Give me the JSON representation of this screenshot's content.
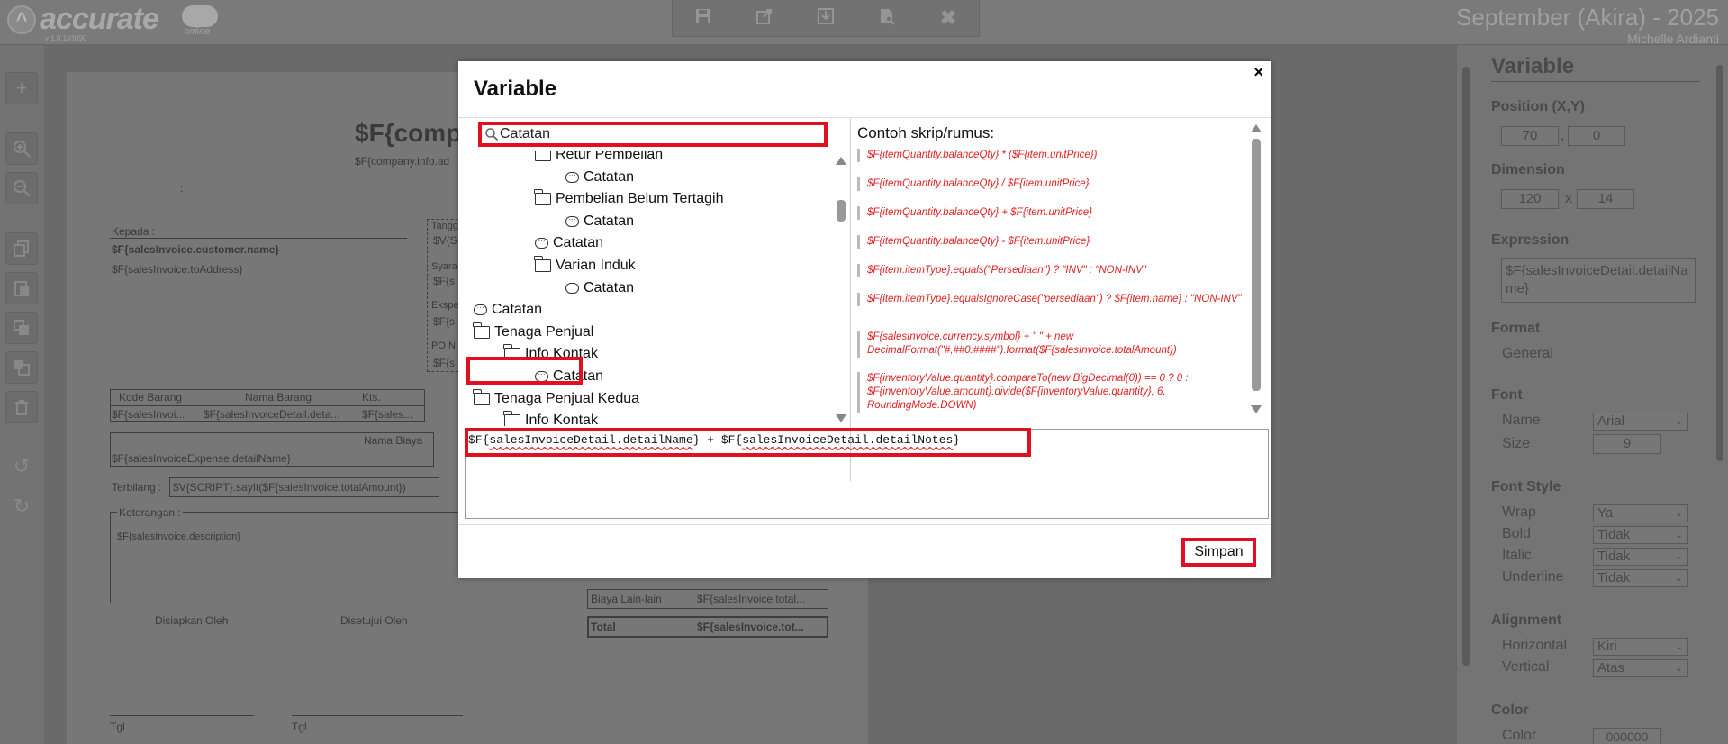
{
  "app": {
    "logo_text": "accurate",
    "logo_sub": "online",
    "version": "v 1.0.1#3090",
    "period": "September (Akira) - 2025",
    "user": "Michelle Ardianti"
  },
  "toolbar": {
    "icons": [
      "save-icon",
      "export-icon",
      "download-icon",
      "preview-icon",
      "close-icon"
    ]
  },
  "leftbar": {
    "icons": [
      "add-icon",
      "zoom-in-icon",
      "zoom-out-icon",
      "copy-icon",
      "paste-icon",
      "bring-front-icon",
      "send-back-icon",
      "delete-icon",
      "undo-icon",
      "redo-icon"
    ]
  },
  "document": {
    "company_name": "$F{compa",
    "company_address": "$F{company.info.ad",
    "colon": ":",
    "to_label": "Kepada :",
    "customer_name": "$F{salesInvoice.customer.name}",
    "to_address": "$F{salesInvoice.toAddress}",
    "date_label": "Tangg",
    "date_var": "$V{S",
    "terms_label": "Syara",
    "terms_var": "$F{s",
    "ship_label": "Ekspe",
    "ship_var": "$F{s",
    "po_label": "PO N",
    "po_var": "$F{s",
    "col_code": "Kode Barang",
    "col_name": "Nama Barang",
    "col_qty": "Kts.",
    "cell_code": "$F{salesInvoi...",
    "cell_name": "$F{salesInvoiceDetail.deta...",
    "cell_qty": "$F{sales...",
    "expense_header": "Nama Biaya",
    "expense_name": "$F{salesInvoiceExpense.detailName}",
    "terbilang_label": "Terbilang :",
    "terbilang_var": "$V{SCRIPT}.sayIt($F{salesInvoice.totalAmount})",
    "notes_label": "Keterangan :",
    "notes_var": "$F{salesInvoice.description}",
    "prepared_by": "Disiapkan Oleh",
    "approved_by": "Disetujui Oleh",
    "date1": "Tgl",
    "date2": "Tgl.",
    "other_cost_label": "Biaya Lain-lain",
    "other_cost_var": "$F{salesInvoice.total...",
    "total_label": "Total",
    "total_var": "$F{salesInvoice.tot..."
  },
  "props": {
    "title": "Variable",
    "position_label": "Position (X,Y)",
    "pos_x": "70",
    "pos_y": "0",
    "pos_sep": ",",
    "dimension_label": "Dimension",
    "dim_w": "120",
    "dim_h": "14",
    "dim_sep": "x",
    "expression_label": "Expression",
    "expression_value": "$F{salesInvoiceDetail.detailName}",
    "format_label": "Format",
    "format_value": "General",
    "font_label": "Font",
    "name_label": "Name",
    "name_value": "Arial",
    "size_label": "Size",
    "size_value": "9",
    "fontstyle_label": "Font Style",
    "wrap_label": "Wrap",
    "wrap_value": "Ya",
    "bold_label": "Bold",
    "bold_value": "Tidak",
    "italic_label": "Italic",
    "italic_value": "Tidak",
    "underline_label": "Underline",
    "underline_value": "Tidak",
    "alignment_label": "Alignment",
    "horizontal_label": "Horizontal",
    "horizontal_value": "Kiri",
    "vertical_label": "Vertical",
    "vertical_value": "Atas",
    "color_label": "Color",
    "color_sub_label": "Color",
    "color_value": "000000"
  },
  "modal": {
    "title": "Variable",
    "close": "×",
    "search_value": "Catatan",
    "tree": [
      {
        "label": "Retur Pembelian",
        "type": "folder",
        "level": 2
      },
      {
        "label": "Catatan",
        "type": "note",
        "level": 3
      },
      {
        "label": "Pembelian Belum Tertagih",
        "type": "folder",
        "level": 2
      },
      {
        "label": "Catatan",
        "type": "note",
        "level": 3
      },
      {
        "label": "Catatan",
        "type": "note",
        "level": 2
      },
      {
        "label": "Varian Induk",
        "type": "folder",
        "level": 2
      },
      {
        "label": "Catatan",
        "type": "note",
        "level": 3
      },
      {
        "label": "Catatan",
        "type": "note",
        "level": 0
      },
      {
        "label": "Tenaga Penjual",
        "type": "folder",
        "level": 0
      },
      {
        "label": "Info Kontak",
        "type": "folder",
        "level": 1
      },
      {
        "label": "Catatan",
        "type": "note",
        "level": 2
      },
      {
        "label": "Tenaga Penjual Kedua",
        "type": "folder",
        "level": 0
      },
      {
        "label": "Info Kontak",
        "type": "folder",
        "level": 1
      }
    ],
    "examples_title": "Contoh skrip/rumus:",
    "examples": [
      "$F{itemQuantity.balanceQty} * ($F{item.unitPrice})",
      "$F{itemQuantity.balanceQty} / $F{item.unitPrice}",
      "$F{itemQuantity.balanceQty} + $F{item.unitPrice}",
      "$F{itemQuantity.balanceQty} - $F{item.unitPrice}",
      "$F{item.itemType}.equals(\"Persediaan\") ? \"INV\" : \"NON-INV\"",
      "$F{item.itemType}.equalsIgnoreCase(\"persediaan\") ? $F{item.name} : \"NON-INV\"",
      "$F{salesInvoice.currency.symbol} + \" \" + new DecimalFormat(\"#,##0.####\").format($F{salesInvoice.totalAmount})",
      "$F{inventoryValue.quantity}.compareTo(new BigDecimal(0)) == 0 ? 0 : $F{inventoryValue.amount}.divide($F{inventoryValue.quantity}, 6, RoundingMode.DOWN)"
    ],
    "expression_parts": [
      "$F{",
      "salesInvoiceDetail.detailName",
      "} + $F{",
      "salesInvoiceDetail.detailNotes",
      "}"
    ],
    "save_label": "Simpan"
  }
}
